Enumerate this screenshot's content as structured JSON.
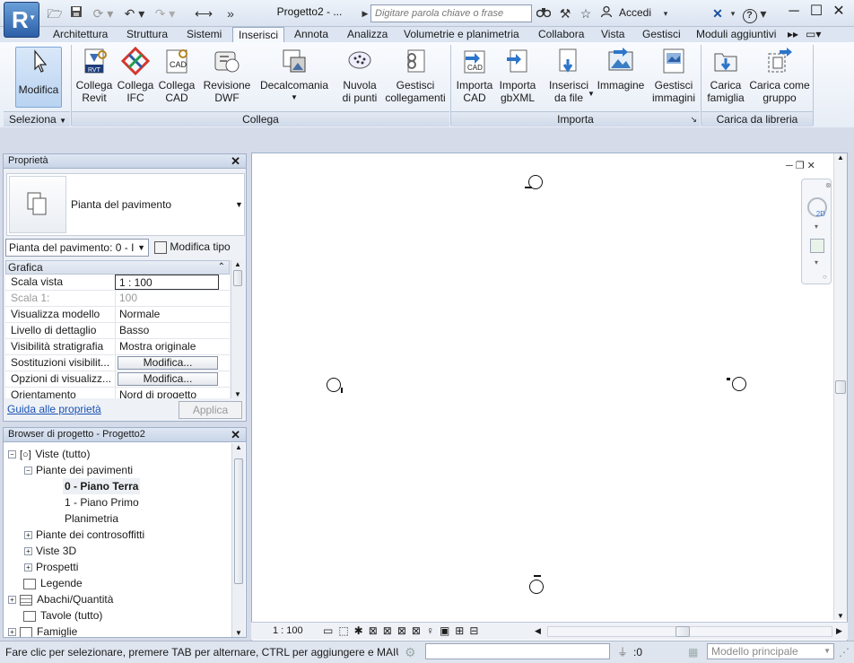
{
  "title_bar": {
    "app_letter": "R",
    "document_title": "Progetto2 - ...",
    "search_placeholder": "Digitare parola chiave o frase",
    "signin_label": "Accedi"
  },
  "ribbon_tabs": [
    "Architettura",
    "Struttura",
    "Sistemi",
    "Inserisci",
    "Annota",
    "Analizza",
    "Volumetrie e planimetria",
    "Collabora",
    "Vista",
    "Gestisci",
    "Moduli aggiuntivi"
  ],
  "active_tab": "Inserisci",
  "ribbon": {
    "modify": "Modifica",
    "collega_revit": [
      "Collega",
      "Revit"
    ],
    "collega_ifc": [
      "Collega",
      "IFC"
    ],
    "collega_cad": [
      "Collega",
      "CAD"
    ],
    "revisione_dwf": [
      "Revisione",
      "DWF"
    ],
    "decalcomania": "Decalcomania",
    "nuvola": [
      "Nuvola",
      "di punti"
    ],
    "gestisci_collegamenti": [
      "Gestisci",
      "collegamenti"
    ],
    "importa_cad": [
      "Importa",
      "CAD"
    ],
    "importa_gbxml": [
      "Importa",
      "gbXML"
    ],
    "inserisci_file": [
      "Inserisci",
      "da file"
    ],
    "immagine": "Immagine",
    "gestisci_immagini": [
      "Gestisci",
      "immagini"
    ],
    "carica_famiglia": [
      "Carica",
      "famiglia"
    ],
    "carica_gruppo": [
      "Carica come",
      "gruppo"
    ],
    "panels": {
      "seleziona": "Seleziona",
      "collega": "Collega",
      "importa": "Importa",
      "carica_libreria": "Carica da libreria"
    }
  },
  "properties": {
    "header": "Proprietà",
    "type_name": "Pianta del pavimento",
    "instance_selector": "Pianta del pavimento: 0 - I",
    "edit_type_label": "Modifica tipo",
    "group": "Grafica",
    "rows": [
      {
        "key": "Scala vista",
        "value": "1 : 100"
      },
      {
        "key": "Scala 1:",
        "value": "100"
      },
      {
        "key": "Visualizza modello",
        "value": "Normale"
      },
      {
        "key": "Livello di dettaglio",
        "value": "Basso"
      },
      {
        "key": "Visibilità stratigrafia",
        "value": "Mostra originale"
      },
      {
        "key": "Sostituzioni visibilit...",
        "value": "Modifica..."
      },
      {
        "key": "Opzioni di visualizz...",
        "value": "Modifica..."
      },
      {
        "key": "Orientamento",
        "value": "Nord di progetto"
      }
    ],
    "help_link": "Guida alle proprietà",
    "apply_label": "Applica"
  },
  "browser": {
    "header": "Browser di progetto - Progetto2",
    "items": [
      {
        "label": "Viste (tutto)"
      },
      {
        "label": "Piante dei pavimenti"
      },
      {
        "label": "0 - Piano Terra"
      },
      {
        "label": "1 - Piano Primo"
      },
      {
        "label": "Planimetria"
      },
      {
        "label": "Piante dei controsoffitti"
      },
      {
        "label": "Viste 3D"
      },
      {
        "label": "Prospetti"
      },
      {
        "label": "Legende"
      },
      {
        "label": "Abachi/Quantità"
      },
      {
        "label": "Tavole (tutto)"
      },
      {
        "label": "Famiglie"
      }
    ]
  },
  "view": {
    "scale": "1 : 100"
  },
  "status": {
    "hint": "Fare clic per selezionare, premere TAB per alternare, CTRL per aggiungere e MAIUSC",
    "count": ":0",
    "model": "Modello principale"
  }
}
